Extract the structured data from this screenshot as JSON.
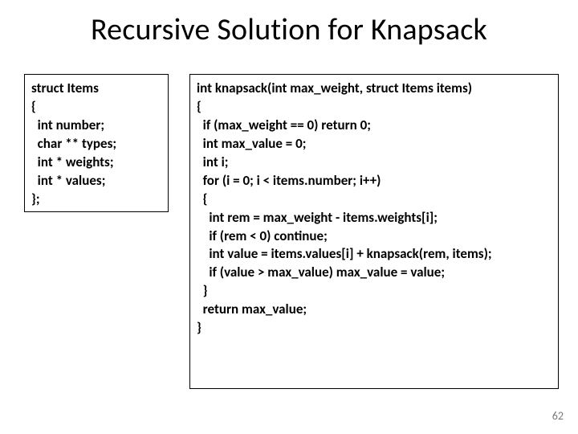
{
  "slide": {
    "title": "Recursive Solution for Knapsack",
    "struct_code": "struct Items\n{\n  int number;\n  char ** types;\n  int * weights;\n  int * values;\n};",
    "function_code": "int knapsack(int max_weight, struct Items items)\n{\n  if (max_weight == 0) return 0;\n  int max_value = 0;\n  int i;\n  for (i = 0; i < items.number; i++)\n  {\n    int rem = max_weight - items.weights[i];\n    if (rem < 0) continue;\n    int value = items.values[i] + knapsack(rem, items);\n    if (value > max_value) max_value = value;\n  }\n  return max_value;\n}",
    "page_number": "62"
  }
}
